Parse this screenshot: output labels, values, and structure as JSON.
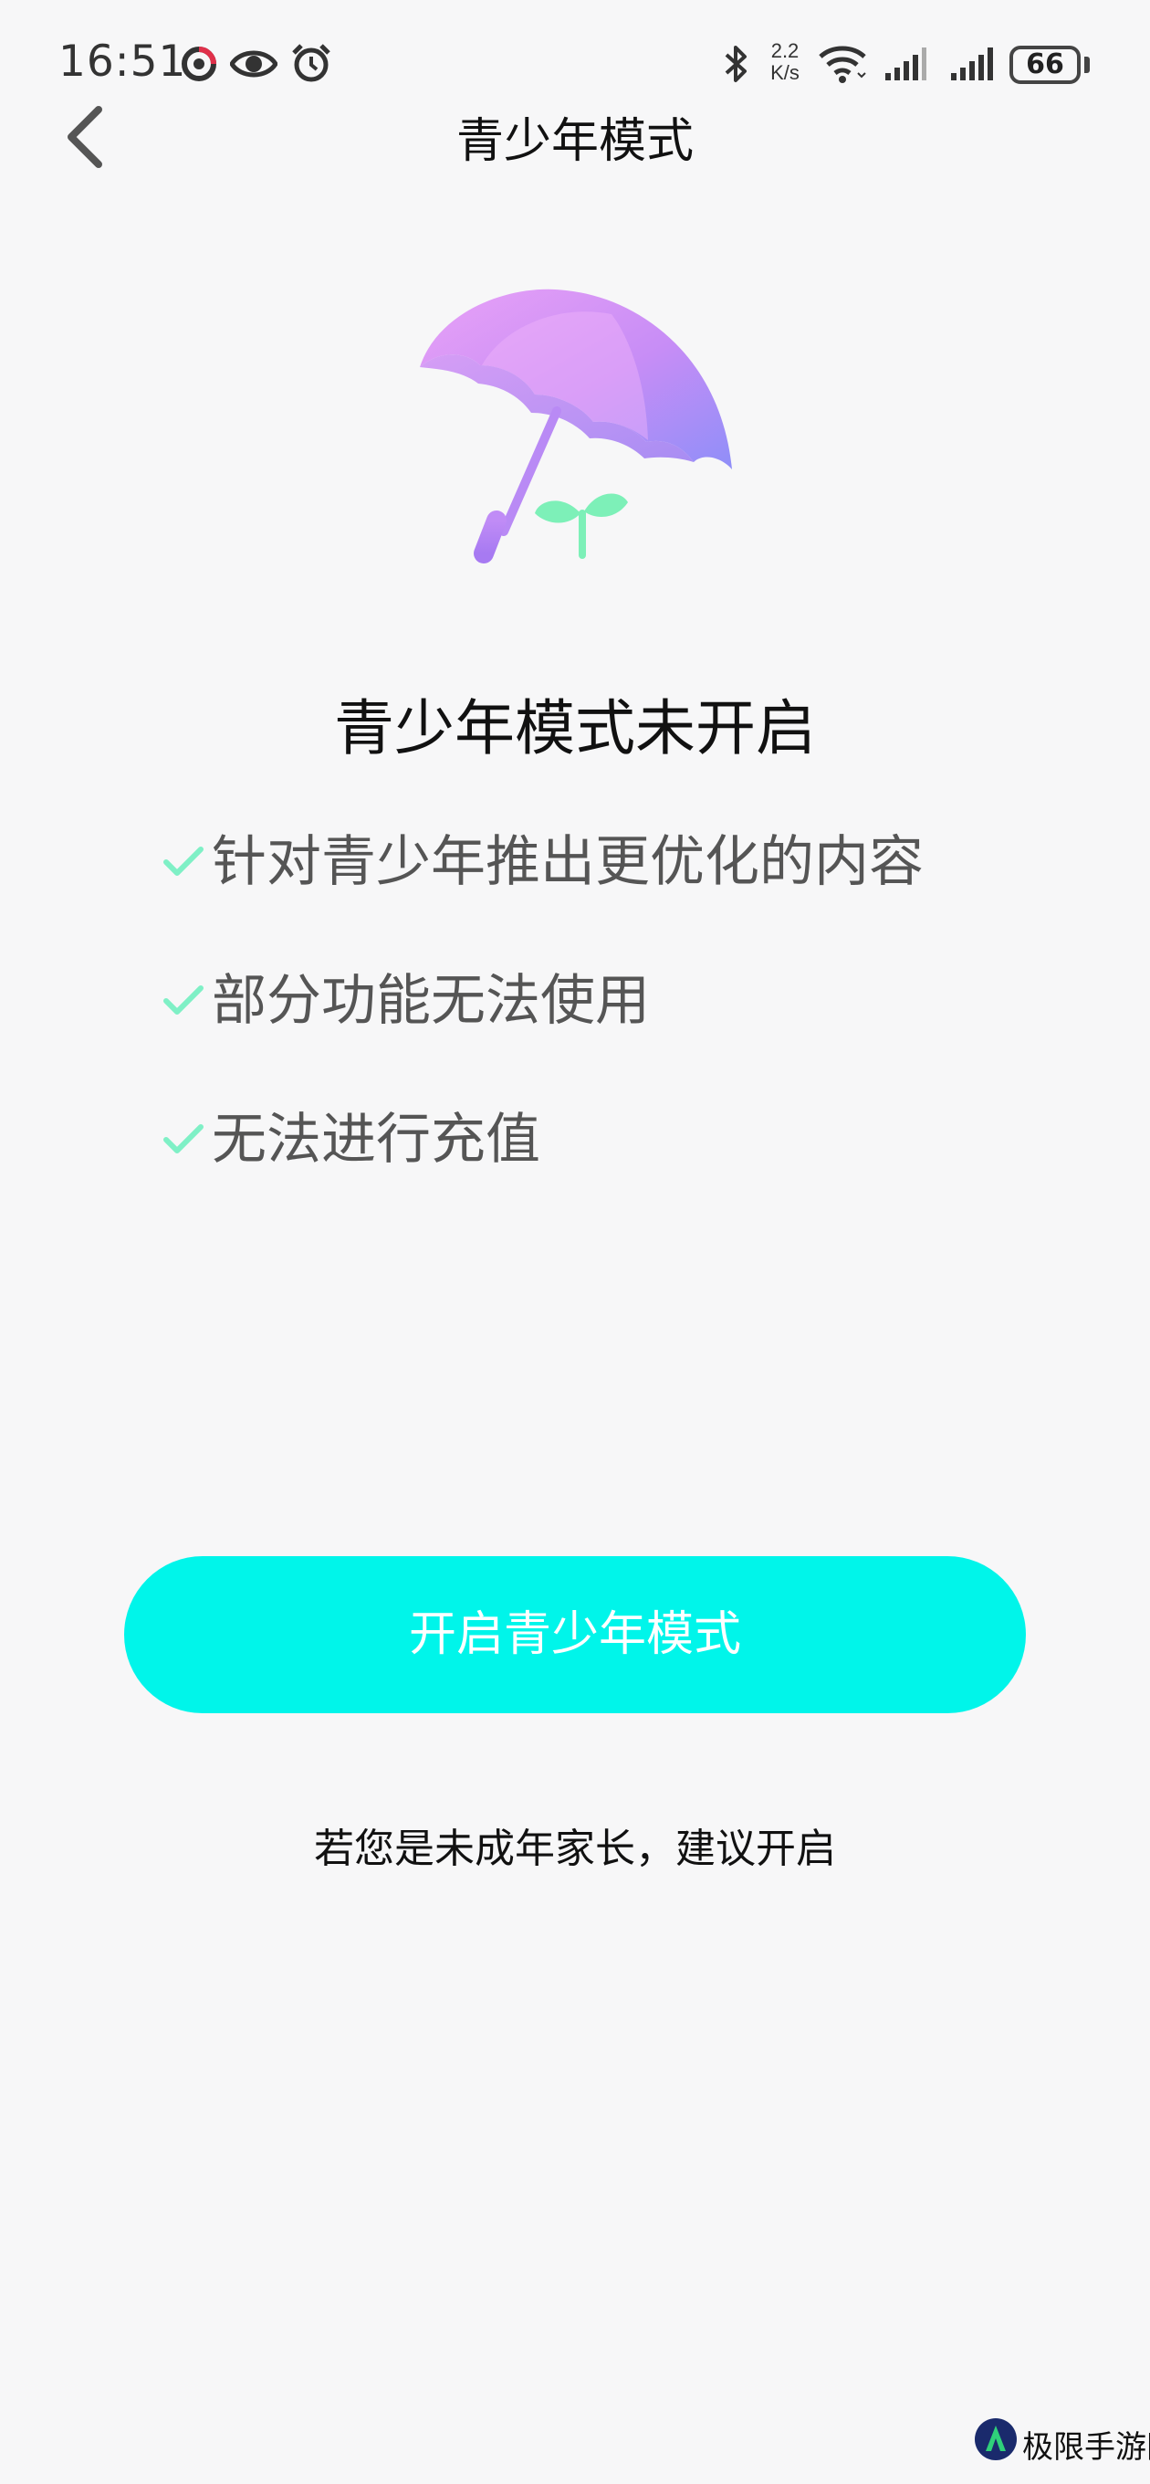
{
  "status_bar": {
    "time": "16:51",
    "net_speed_value": "2.2",
    "net_speed_unit": "K/s",
    "battery": "66",
    "icons": [
      "record-ring-icon",
      "eye-icon",
      "alarm-icon",
      "bluetooth-icon",
      "wifi-icon",
      "signal-icon",
      "signal-icon",
      "battery-icon"
    ]
  },
  "nav": {
    "back_icon": "chevron-left-icon",
    "title": "青少年模式"
  },
  "illustration": {
    "icons": [
      "umbrella-icon",
      "sprout-icon"
    ],
    "colors": {
      "umbrella_light": "#e39bf6",
      "umbrella_dark": "#8e8cf8",
      "sprout": "#7df0b8"
    }
  },
  "content": {
    "status_title": "青少年模式未开启",
    "features": [
      "针对青少年推出更优化的内容",
      "部分功能无法使用",
      "无法进行充值"
    ],
    "check_color": "#7ff0c6"
  },
  "action": {
    "enable_label": "开启青少年模式",
    "enable_color": "#00f5ea",
    "hint": "若您是未成年家长，建议开启"
  },
  "watermark": {
    "text": "极限手游网"
  }
}
